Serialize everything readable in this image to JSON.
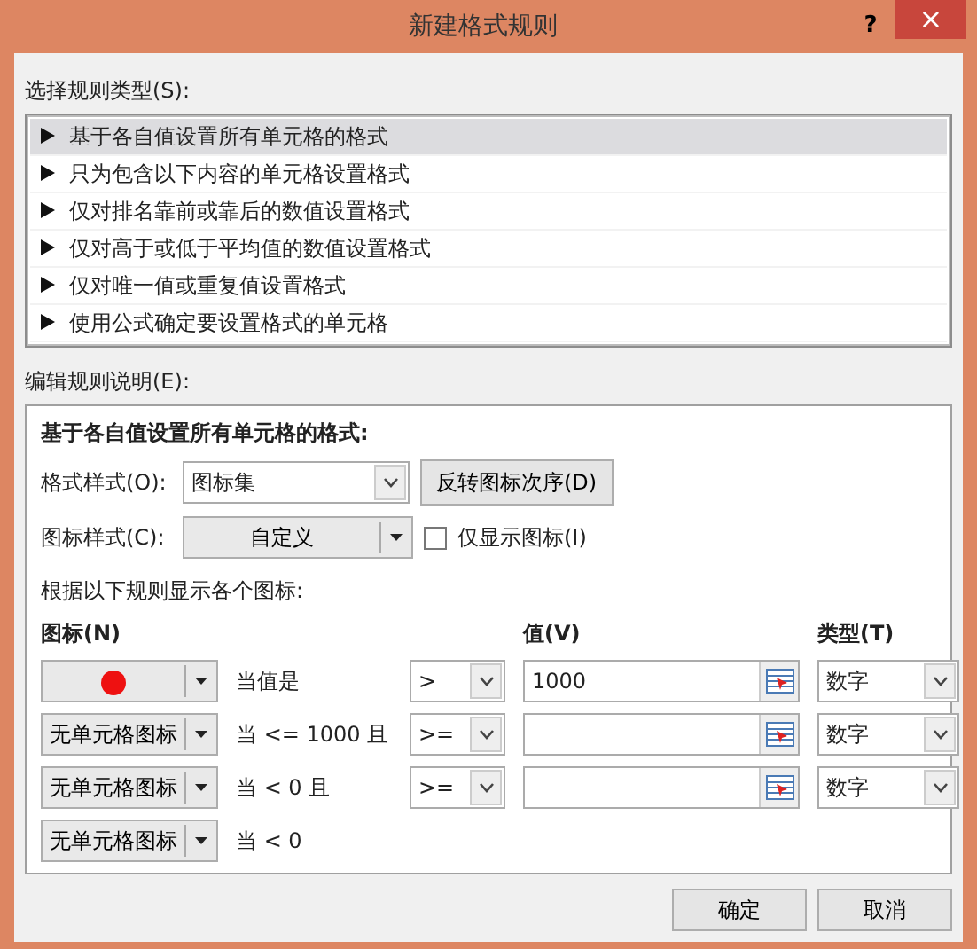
{
  "window": {
    "title": "新建格式规则",
    "help": "?",
    "close": "×"
  },
  "rule_type": {
    "label": "选择规则类型(S):",
    "items": [
      {
        "label": "基于各自值设置所有单元格的格式",
        "selected": true
      },
      {
        "label": "只为包含以下内容的单元格设置格式",
        "selected": false
      },
      {
        "label": "仅对排名靠前或靠后的数值设置格式",
        "selected": false
      },
      {
        "label": "仅对高于或低于平均值的数值设置格式",
        "selected": false
      },
      {
        "label": "仅对唯一值或重复值设置格式",
        "selected": false
      },
      {
        "label": "使用公式确定要设置格式的单元格",
        "selected": false
      }
    ]
  },
  "rule_description": {
    "label": "编辑规则说明(E):",
    "heading": "基于各自值设置所有单元格的格式:",
    "format_style": {
      "label": "格式样式(O):",
      "value": "图标集"
    },
    "reverse_button": "反转图标次序(D)",
    "icon_style": {
      "label": "图标样式(C):",
      "value": "自定义"
    },
    "show_icon_only": {
      "label": "仅显示图标(I)",
      "checked": false
    },
    "rules_caption": "根据以下规则显示各个图标:",
    "columns": {
      "icon": "图标(N)",
      "value": "值(V)",
      "type": "类型(T)"
    },
    "rules": [
      {
        "icon": {
          "kind": "dot",
          "color": "#ee1111"
        },
        "condition": "当值是",
        "operator": ">",
        "value": "1000",
        "type": "数字"
      },
      {
        "icon": {
          "kind": "text",
          "label": "无单元格图标"
        },
        "condition": "当 <= 1000 且",
        "operator": ">=",
        "type": "数字"
      },
      {
        "icon": {
          "kind": "text",
          "label": "无单元格图标"
        },
        "condition": "当 < 0 且",
        "operator": ">=",
        "type": "数字"
      },
      {
        "icon": {
          "kind": "text",
          "label": "无单元格图标"
        },
        "condition": "当 < 0"
      }
    ]
  },
  "buttons": [
    "确定",
    "取消"
  ]
}
